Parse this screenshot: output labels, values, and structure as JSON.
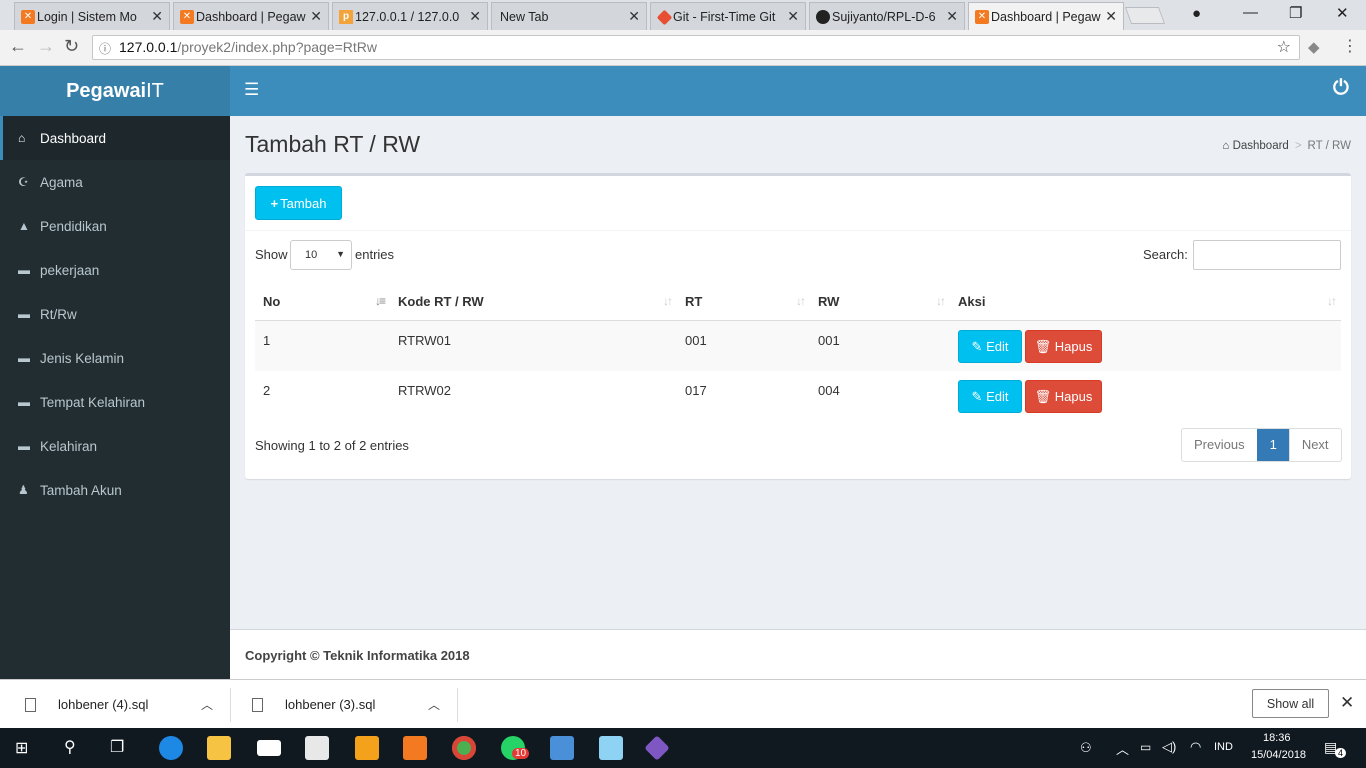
{
  "browser": {
    "tabs": [
      {
        "title": "Login | Sistem Mo",
        "favicon": "xampp-icon",
        "color": "#f37a20"
      },
      {
        "title": "Dashboard | Pegaw",
        "favicon": "xampp-icon",
        "color": "#f37a20"
      },
      {
        "title": "127.0.0.1 / 127.0.0",
        "favicon": "phpmyadmin-icon",
        "color": "#f2a33a"
      },
      {
        "title": "New Tab",
        "favicon": "",
        "color": ""
      },
      {
        "title": "Git - First-Time Git",
        "favicon": "git-icon",
        "color": "#e84e31"
      },
      {
        "title": "Sujiyanto/RPL-D-6",
        "favicon": "github-icon",
        "color": "#222222"
      },
      {
        "title": "Dashboard | Pegaw",
        "favicon": "xampp-icon",
        "color": "#f37a20"
      }
    ],
    "active_tab": 6,
    "url_host": "127.0.0.1",
    "url_path": "/proyek2/index.php?page=RtRw"
  },
  "app": {
    "logo_bold": "Pegawai",
    "logo_light": "IT",
    "brand_color": "#3c8dbc"
  },
  "sidebar": {
    "items": [
      {
        "label": "Dashboard",
        "icon": "home-icon"
      },
      {
        "label": "Agama",
        "icon": "moon-icon"
      },
      {
        "label": "Pendidikan",
        "icon": "graduation-cap-icon"
      },
      {
        "label": "pekerjaan",
        "icon": "briefcase-icon"
      },
      {
        "label": "Rt/Rw",
        "icon": "briefcase-icon"
      },
      {
        "label": "Jenis Kelamin",
        "icon": "briefcase-icon"
      },
      {
        "label": "Tempat Kelahiran",
        "icon": "briefcase-icon"
      },
      {
        "label": "Kelahiran",
        "icon": "briefcase-icon"
      },
      {
        "label": "Tambah Akun",
        "icon": "user-plus-icon"
      }
    ],
    "active_index": 0
  },
  "page": {
    "title": "Tambah RT / RW",
    "breadcrumb": [
      "Dashboard",
      "RT / RW"
    ],
    "add_button": "Tambah"
  },
  "table": {
    "show_label": "Show",
    "page_length": "10",
    "entries_label": "entries",
    "search_label": "Search:",
    "search_value": "",
    "columns": [
      "No",
      "Kode RT / RW",
      "RT",
      "RW",
      "Aksi"
    ],
    "rows": [
      {
        "no": "1",
        "kode": "RTRW01",
        "rt": "001",
        "rw": "001"
      },
      {
        "no": "2",
        "kode": "RTRW02",
        "rt": "017",
        "rw": "004"
      }
    ],
    "edit_label": "Edit",
    "delete_label": "Hapus",
    "info": "Showing 1 to 2 of 2 entries",
    "pagination": {
      "previous": "Previous",
      "current": "1",
      "next": "Next"
    }
  },
  "footer": {
    "text": "Copyright © Teknik Informatika 2018"
  },
  "downloads": {
    "files": [
      "lohbener (4).sql",
      "lohbener (3).sql"
    ],
    "show_all": "Show all"
  },
  "taskbar": {
    "language": "IND",
    "time": "18:36",
    "date": "15/04/2018",
    "notifications": "4",
    "whatsapp_badge": "10"
  }
}
